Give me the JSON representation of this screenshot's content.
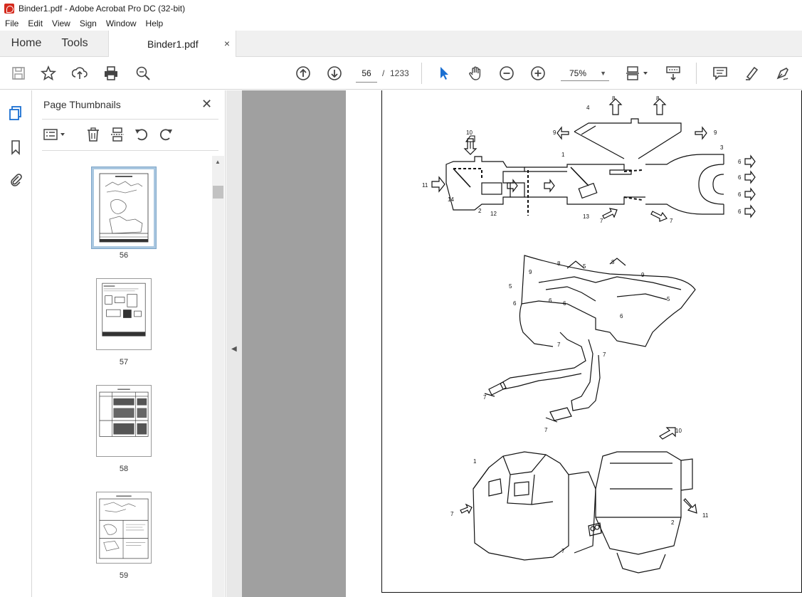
{
  "window": {
    "title": "Binder1.pdf - Adobe Acrobat Pro DC (32-bit)"
  },
  "menu": [
    "File",
    "Edit",
    "View",
    "Sign",
    "Window",
    "Help"
  ],
  "tabs": {
    "home": "Home",
    "tools": "Tools",
    "document": "Binder1.pdf",
    "close": "×"
  },
  "toolbar": {
    "current_page": "56",
    "separator": "/",
    "total_pages": "1233",
    "zoom": "75%",
    "icons": [
      "save-icon",
      "star-icon",
      "upload-icon",
      "print-icon",
      "zoom-search-icon",
      "page-up-icon",
      "page-down-icon",
      "select-cursor-icon",
      "hand-icon",
      "zoom-out-icon",
      "zoom-in-icon",
      "page-display-icon",
      "scroll-mode-icon",
      "comment-icon",
      "highlight-icon",
      "sign-icon"
    ]
  },
  "panel": {
    "title": "Page Thumbnails",
    "close": "✕",
    "thumbnails": [
      {
        "label": "56",
        "selected": true
      },
      {
        "label": "57",
        "selected": false
      },
      {
        "label": "58",
        "selected": false
      },
      {
        "label": "59",
        "selected": false
      }
    ]
  },
  "diagram": {
    "labels": [
      "1",
      "2",
      "3",
      "4",
      "6",
      "7",
      "8",
      "9",
      "10",
      "11",
      "12",
      "13",
      "14",
      "5"
    ]
  }
}
